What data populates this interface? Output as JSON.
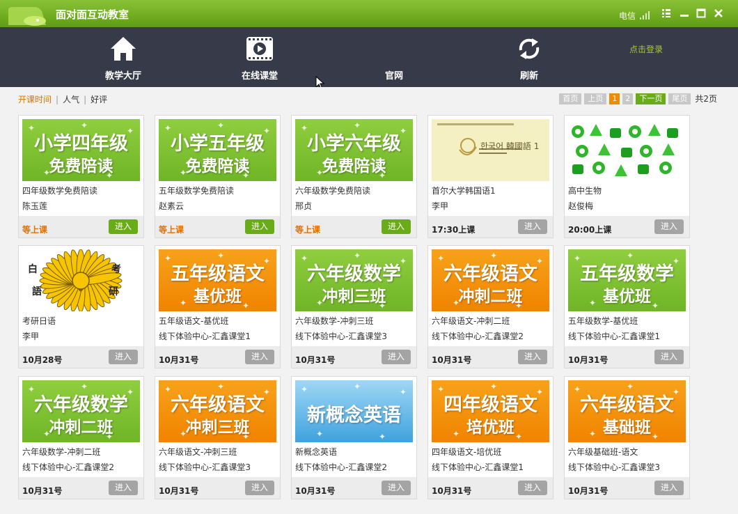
{
  "app": {
    "title": "面对面互动教室",
    "isp": "电信"
  },
  "nav": {
    "items": [
      {
        "label": "教学大厅",
        "icon": "home-icon"
      },
      {
        "label": "在线课堂",
        "icon": "video-icon"
      },
      {
        "label": "官网",
        "icon": ""
      },
      {
        "label": "刷新",
        "icon": "refresh-icon"
      }
    ],
    "login": "点击登录"
  },
  "filter": {
    "sort": [
      "开课时间",
      "人气",
      "好评"
    ],
    "active": "开课时间"
  },
  "pager": {
    "first": "首页",
    "prev": "上页",
    "pages": [
      "1",
      "2"
    ],
    "current": "1",
    "next": "下一页",
    "last": "尾页",
    "total": "共2页"
  },
  "enter_label": "进入",
  "courses": [
    {
      "thumb_l1": "小学四年级",
      "thumb_l2": "免费陪读",
      "theme": "green",
      "title": "四年级数学免费陪读",
      "teacher": "陈玉莲",
      "time": "等上课",
      "status": "waiting"
    },
    {
      "thumb_l1": "小学五年级",
      "thumb_l2": "免费陪读",
      "theme": "green",
      "title": "五年级数学免费陪读",
      "teacher": "赵素云",
      "time": "等上课",
      "status": "waiting"
    },
    {
      "thumb_l1": "小学六年级",
      "thumb_l2": "免费陪读",
      "theme": "green",
      "title": "六年级数学免费陪读",
      "teacher": "邢贞",
      "time": "等上课",
      "status": "waiting"
    },
    {
      "thumb_l1": "한국어 韓國語 1",
      "thumb_l2": "",
      "theme": "book",
      "title": "首尔大学韩国语1",
      "teacher": "李甲",
      "time": "17:30上课",
      "status": "scheduled"
    },
    {
      "thumb_l1": "",
      "thumb_l2": "",
      "theme": "bio",
      "title": "高中生物",
      "teacher": "赵俊梅",
      "time": "20:00上课",
      "status": "scheduled"
    },
    {
      "thumb_l1": "",
      "thumb_l2": "",
      "theme": "seal",
      "title": "考研日语",
      "teacher": "李甲",
      "time": "10月28号",
      "status": "scheduled"
    },
    {
      "thumb_l1": "五年级语文",
      "thumb_l2": "基优班",
      "theme": "orange",
      "title": "五年级语文-基优班",
      "teacher": "线下体验中心-汇鑫课堂1",
      "time": "10月31号",
      "status": "scheduled"
    },
    {
      "thumb_l1": "六年级数学",
      "thumb_l2": "冲刺三班",
      "theme": "green",
      "title": "六年级数学-冲刺三班",
      "teacher": "线下体验中心-汇鑫课堂3",
      "time": "10月31号",
      "status": "scheduled"
    },
    {
      "thumb_l1": "六年级语文",
      "thumb_l2": "冲刺二班",
      "theme": "orange",
      "title": "六年级语文-冲刺二班",
      "teacher": "线下体验中心-汇鑫课堂2",
      "time": "10月31号",
      "status": "scheduled"
    },
    {
      "thumb_l1": "五年级数学",
      "thumb_l2": "基优班",
      "theme": "green",
      "title": "五年级数学-基优班",
      "teacher": "线下体验中心-汇鑫课堂1",
      "time": "10月31号",
      "status": "scheduled"
    },
    {
      "thumb_l1": "六年级数学",
      "thumb_l2": "冲刺二班",
      "theme": "green",
      "title": "六年级数学-冲刺二班",
      "teacher": "线下体验中心-汇鑫课堂2",
      "time": "10月31号",
      "status": "scheduled"
    },
    {
      "thumb_l1": "六年级语文",
      "thumb_l2": "冲刺三班",
      "theme": "orange",
      "title": "六年级语文-冲刺三班",
      "teacher": "线下体验中心-汇鑫课堂3",
      "time": "10月31号",
      "status": "scheduled"
    },
    {
      "thumb_l1": "新概念英语",
      "thumb_l2": "",
      "theme": "blue",
      "title": "新概念英语",
      "teacher": "线下体验中心-汇鑫课堂2",
      "time": "10月31号",
      "status": "scheduled"
    },
    {
      "thumb_l1": "四年级语文",
      "thumb_l2": "培优班",
      "theme": "orange",
      "title": "四年级语文-培优班",
      "teacher": "线下体验中心-汇鑫课堂1",
      "time": "10月31号",
      "status": "scheduled"
    },
    {
      "thumb_l1": "六年级语文",
      "thumb_l2": "基础班",
      "theme": "orange",
      "title": "六年级基础班-语文",
      "teacher": "线下体验中心-汇鑫课堂3",
      "time": "10月31号",
      "status": "scheduled"
    }
  ],
  "seal_chars": [
    "白",
    "考",
    "語",
    "研"
  ],
  "colors": {
    "title_bar": "#6aac17",
    "nav_bar": "#373a48",
    "accent_orange": "#e57000",
    "enter_green": "#6aac17",
    "enter_gray": "#a4a4a4"
  }
}
